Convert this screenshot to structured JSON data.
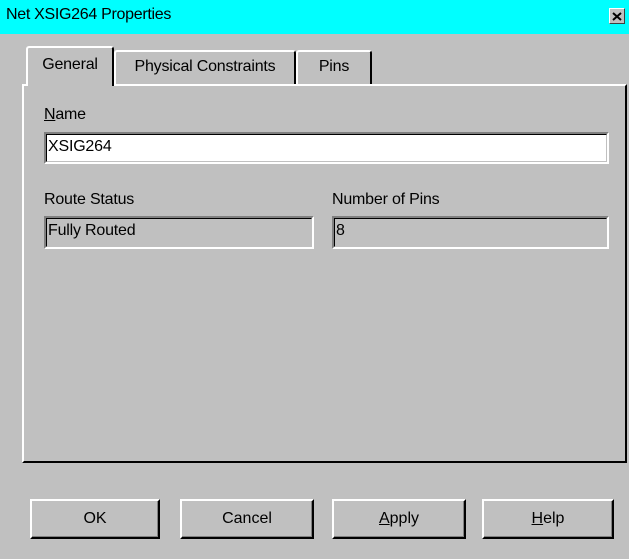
{
  "window": {
    "title": "Net XSIG264 Properties"
  },
  "tabs": [
    {
      "label": "General",
      "active": true
    },
    {
      "label": "Physical Constraints",
      "active": false
    },
    {
      "label": "Pins",
      "active": false
    }
  ],
  "general": {
    "name_label_first": "N",
    "name_label_rest": "ame",
    "name_value": "XSIG264",
    "route_status_label": "Route Status",
    "route_status_value": "Fully Routed",
    "num_pins_label": "Number of Pins",
    "num_pins_value": "8"
  },
  "buttons": {
    "ok": "OK",
    "cancel": "Cancel",
    "apply_mnemonic": "A",
    "apply_rest": "pply",
    "help_mnemonic": "H",
    "help_rest": "elp"
  },
  "colors": {
    "titlebar": "#00ffff",
    "face": "#c0c0c0"
  },
  "icons": {
    "close": "close-icon"
  }
}
